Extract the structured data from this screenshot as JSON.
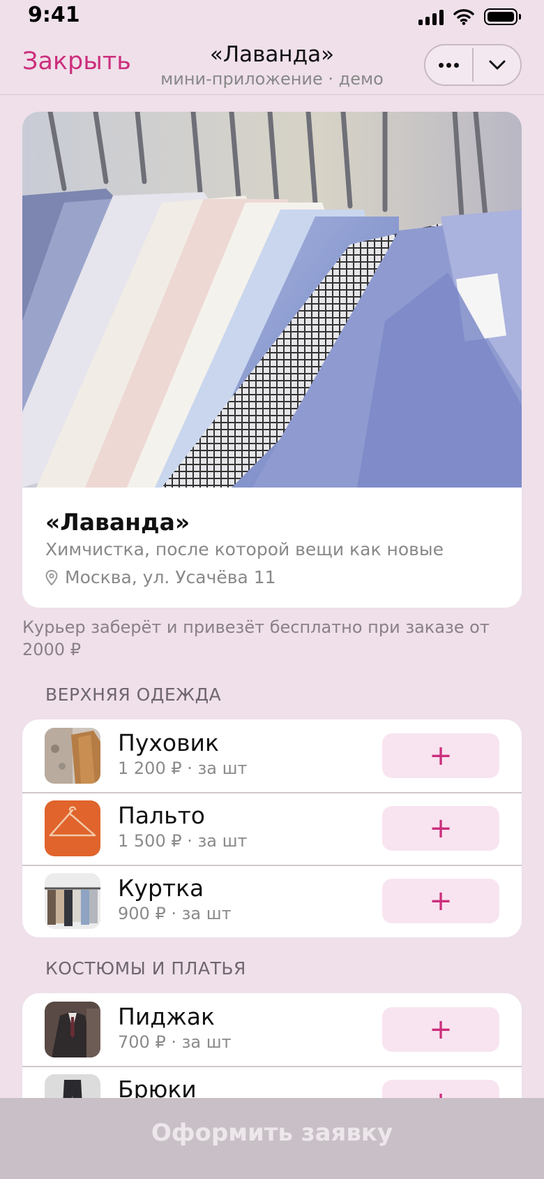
{
  "status_bar": {
    "time": "9:41"
  },
  "header": {
    "close_label": "Закрыть",
    "title": "«Лаванда»",
    "subtitle": "мини-приложение · демо",
    "more_icon": "more-dots-icon",
    "collapse_icon": "chevron-down-icon"
  },
  "shop": {
    "name": "«Лаванда»",
    "tagline": "Химчистка, после которой вещи как новые",
    "address": "Москва, ул. Усачёва 11",
    "address_icon": "location-pin-icon"
  },
  "delivery_note": "Курьер заберёт и привезёт бесплатно при заказе от 2000 ₽",
  "sections": [
    {
      "title": "ВЕРХНЯЯ ОДЕЖДА",
      "items": [
        {
          "name": "Пуховик",
          "price": "1 200 ₽ · за шт",
          "add_label": "+"
        },
        {
          "name": "Пальто",
          "price": "1 500 ₽ · за шт",
          "add_label": "+"
        },
        {
          "name": "Куртка",
          "price": "900 ₽ · за шт",
          "add_label": "+"
        }
      ]
    },
    {
      "title": "КОСТЮМЫ И ПЛАТЬЯ",
      "items": [
        {
          "name": "Пиджак",
          "price": "700 ₽ · за шт",
          "add_label": "+"
        },
        {
          "name": "Брюки",
          "price": "",
          "add_label": "+"
        }
      ]
    }
  ],
  "bottom": {
    "submit_label": "Оформить заявку"
  },
  "colors": {
    "accent": "#cc2e7c",
    "background": "#efe0ea",
    "add_button_bg": "#f8e4f0",
    "disabled_bar": "#c8c0c6"
  }
}
